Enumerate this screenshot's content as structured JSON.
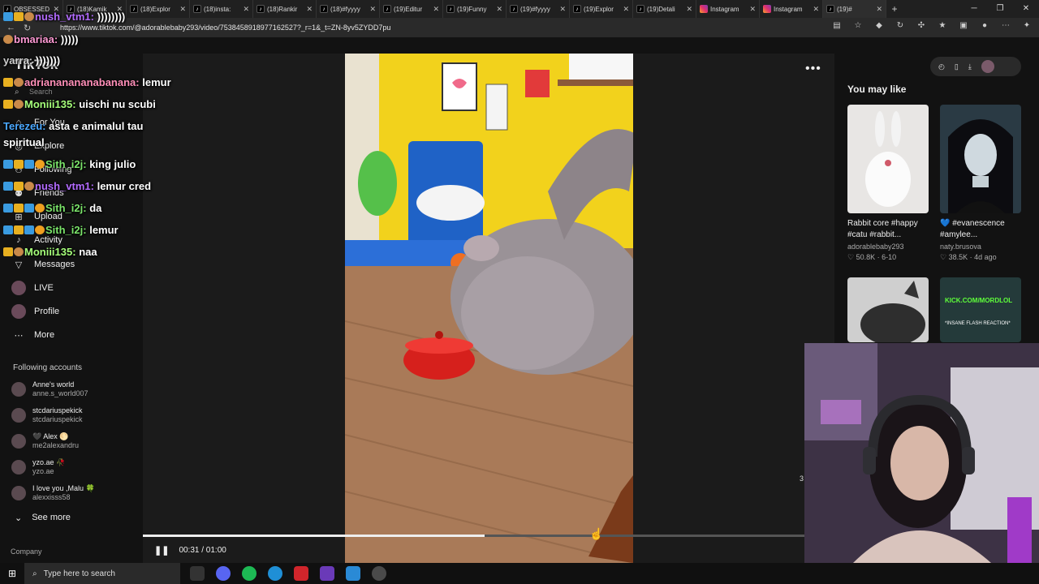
{
  "browser": {
    "tabs": [
      {
        "label": "OBSESSED",
        "icon": "tiktok-icon"
      },
      {
        "label": "(18)Kamik",
        "icon": "tiktok-icon"
      },
      {
        "label": "(18)Explor",
        "icon": "tiktok-icon"
      },
      {
        "label": "(18)insta:",
        "icon": "tiktok-icon"
      },
      {
        "label": "(18)Rankir",
        "icon": "tiktok-icon"
      },
      {
        "label": "(18)#fyyyy",
        "icon": "tiktok-icon"
      },
      {
        "label": "(19)Editur",
        "icon": "tiktok-icon"
      },
      {
        "label": "(19)Funny",
        "icon": "tiktok-icon"
      },
      {
        "label": "(19)#fyyyy",
        "icon": "tiktok-icon"
      },
      {
        "label": "(19)Explor",
        "icon": "tiktok-icon"
      },
      {
        "label": "(19)Detali",
        "icon": "tiktok-icon"
      },
      {
        "label": "Instagram",
        "icon": "instagram-icon"
      },
      {
        "label": "Instagram",
        "icon": "instagram-icon"
      },
      {
        "label": "(19)#",
        "icon": "tiktok-icon"
      }
    ],
    "url": "https://www.tiktok.com/@adorablebaby293/video/7538458918977162527?_r=1&_t=ZN-8yv5ZYDD7pu"
  },
  "sidebar": {
    "brand": "TikTok",
    "search_placeholder": "Search",
    "nav": [
      {
        "label": "For You",
        "icon": "home-icon"
      },
      {
        "label": "Explore",
        "icon": "compass-icon"
      },
      {
        "label": "Following",
        "icon": "following-icon"
      },
      {
        "label": "Friends",
        "icon": "friends-icon"
      },
      {
        "label": "Upload",
        "icon": "plus-icon"
      },
      {
        "label": "Activity",
        "icon": "bell-icon"
      },
      {
        "label": "Messages",
        "icon": "message-icon"
      },
      {
        "label": "LIVE",
        "icon": "live-icon"
      },
      {
        "label": "Profile",
        "icon": "profile-icon"
      },
      {
        "label": "More",
        "icon": "more-icon"
      }
    ],
    "following_header": "Following accounts",
    "accounts": [
      {
        "name": "Anne's world",
        "handle": "anne.s_world007"
      },
      {
        "name": "stcdariuspekick",
        "handle": "stcdariuspekick"
      },
      {
        "name": "🖤 Alex 🌕",
        "handle": "me2alexandru"
      },
      {
        "name": "yzo.ae 🥀",
        "handle": "yzo.ae"
      },
      {
        "name": "I love you ,Malu 🍀",
        "handle": "alexxisss58"
      }
    ],
    "see_more": "See more",
    "company": "Company"
  },
  "chat": [
    {
      "user": "nush_vtm1:",
      "msg": "))))))))",
      "color": "#b36bff"
    },
    {
      "user": "bmariaa:",
      "msg": ")))))",
      "color": "#ff9ad5"
    },
    {
      "user": "yarra:",
      "msg": ")))))))",
      "color": "#cfcfcf"
    },
    {
      "user": "adriananananabanana:",
      "msg": "lemur",
      "color": "#ff8fb8"
    },
    {
      "user": "Moniii135:",
      "msg": "uischi nu scubi",
      "color": "#a6ff7a"
    },
    {
      "user": "Terezeu:",
      "msg": "asta e animalul tau",
      "color": "#4aa8ff"
    },
    {
      "user": "",
      "msg": "spiritual",
      "color": "#ffffff"
    },
    {
      "user": "Sith_i2j:",
      "msg": "king julio",
      "color": "#7be56a"
    },
    {
      "user": "nush_vtm1:",
      "msg": "lemur cred",
      "color": "#b36bff"
    },
    {
      "user": "Sith_i2j:",
      "msg": "da",
      "color": "#7be56a"
    },
    {
      "user": "Sith_i2j:",
      "msg": "lemur",
      "color": "#7be56a"
    },
    {
      "user": "Moniii135:",
      "msg": "naa",
      "color": "#a6ff7a"
    }
  ],
  "player": {
    "time": "00:31 / 01:00",
    "progress": 0.517,
    "menu_label": "•••"
  },
  "recommend": {
    "header": "You may like",
    "items": [
      {
        "caption": "Rabbit core #happy #catu #rabbit...",
        "author": "adorablebaby293",
        "stats": "♡ 50.8K · 6-10"
      },
      {
        "caption": "💙 #evanescence #amylee...",
        "author": "naty.brusova",
        "stats": "♡ 38.5K · 4d ago"
      }
    ],
    "thumb3_text": "KICK.COM/MORDLOL",
    "thumb4_text": "*INSANE FLASH REACTION*"
  },
  "taskbar": {
    "search_placeholder": "Type here to search"
  },
  "overlay_digit": "3"
}
